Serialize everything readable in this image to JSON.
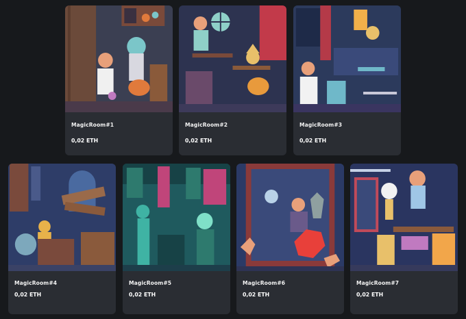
{
  "currency": "ETH",
  "cards": [
    {
      "title": "MagicRoom#1",
      "price": "0,02 ETH",
      "palette": {
        "bg": "#3b3f52",
        "wall": "#6b4a3a",
        "accent": "#e07a3c",
        "accent2": "#7bc6c9",
        "floor": "#4a3a4a"
      }
    },
    {
      "title": "MagicRoom#2",
      "price": "0,02 ETH",
      "palette": {
        "bg": "#2d3350",
        "wall": "#c23a4a",
        "accent": "#e89a3c",
        "accent2": "#8fd0c8",
        "floor": "#3d3a5a"
      }
    },
    {
      "title": "MagicRoom#3",
      "price": "0,02 ETH",
      "palette": {
        "bg": "#2c3a5c",
        "wall": "#b43a48",
        "accent": "#f2b04a",
        "accent2": "#6fb8c9",
        "floor": "#3a3560"
      }
    },
    {
      "title": "MagicRoom#4",
      "price": "0,02 ETH",
      "palette": {
        "bg": "#2e3d68",
        "wall": "#7a4a3c",
        "accent": "#e8b24a",
        "accent2": "#9fd6e0",
        "floor": "#3a4266"
      }
    },
    {
      "title": "MagicRoom#5",
      "price": "0,02 ETH",
      "palette": {
        "bg": "#1f5a5e",
        "wall": "#c0457a",
        "accent": "#3fb3a4",
        "accent2": "#7fe0c8",
        "floor": "#1d3e4a"
      }
    },
    {
      "title": "MagicRoom#6",
      "price": "0,02 ETH",
      "palette": {
        "bg": "#2b3a66",
        "wall": "#8a3a3a",
        "accent": "#e8403a",
        "accent2": "#b9d2e8",
        "floor": "#2e3354"
      }
    },
    {
      "title": "MagicRoom#7",
      "price": "0,02 ETH",
      "palette": {
        "bg": "#2a3560",
        "wall": "#c04a5a",
        "accent": "#f2a64a",
        "accent2": "#c6d2e6",
        "floor": "#363a5c"
      }
    }
  ]
}
